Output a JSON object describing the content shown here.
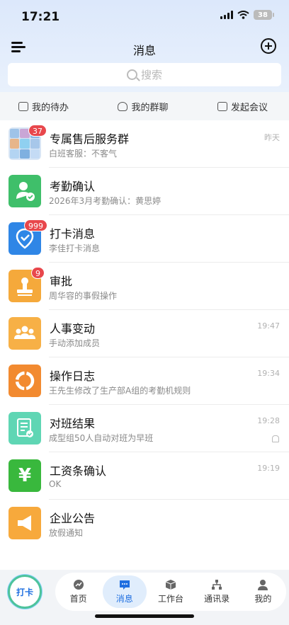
{
  "status": {
    "time": "17:21",
    "battery": "38"
  },
  "header": {
    "title": "消息"
  },
  "search": {
    "placeholder": "搜索"
  },
  "quick_actions": [
    {
      "label": "我的待办",
      "icon": "todo-icon"
    },
    {
      "label": "我的群聊",
      "icon": "group-chat-icon"
    },
    {
      "label": "发起会议",
      "icon": "meeting-icon"
    }
  ],
  "messages": [
    {
      "title": "专属售后服务群",
      "subtitle": "白班客服：不客气",
      "time": "昨天",
      "badge": "37",
      "icon": "group-avatar-icon",
      "color": "#d9e6f5"
    },
    {
      "title": "考勤确认",
      "subtitle": "2026年3月考勤确认：黄思婷",
      "time": "",
      "badge": "",
      "icon": "attendance-confirm-icon",
      "color": "#3fbf6a"
    },
    {
      "title": "打卡消息",
      "subtitle": "李佳打卡消息",
      "time": "",
      "badge": "999",
      "icon": "location-check-icon",
      "color": "#2f86e6"
    },
    {
      "title": "审批",
      "subtitle": "周华容的事假操作",
      "time": "",
      "badge": "9",
      "icon": "stamp-icon",
      "color": "#f5a93b"
    },
    {
      "title": "人事变动",
      "subtitle": "手动添加成员",
      "time": "19:47",
      "badge": "",
      "icon": "people-icon",
      "color": "#f7b046"
    },
    {
      "title": "操作日志",
      "subtitle": "王先生修改了生产部A组的考勤机规则",
      "time": "19:34",
      "badge": "",
      "icon": "log-ring-icon",
      "color": "#f28a30"
    },
    {
      "title": "对班结果",
      "subtitle": "成型组50人自动对班为早班",
      "time": "19:28",
      "badge": "",
      "icon": "document-check-icon",
      "color": "#5fd6b4",
      "muted": true
    },
    {
      "title": "工资条确认",
      "subtitle": "OK",
      "time": "19:19",
      "badge": "",
      "icon": "yen-icon",
      "color": "#39b83d"
    },
    {
      "title": "企业公告",
      "subtitle": "放假通知",
      "time": "",
      "badge": "",
      "icon": "megaphone-icon",
      "color": "#f7a93c"
    }
  ],
  "tabbar": {
    "punch_label": "打卡",
    "tabs": [
      {
        "label": "首页",
        "icon": "home-icon"
      },
      {
        "label": "消息",
        "icon": "message-icon",
        "active": true
      },
      {
        "label": "工作台",
        "icon": "workbench-icon"
      },
      {
        "label": "通讯录",
        "icon": "contacts-icon"
      },
      {
        "label": "我的",
        "icon": "profile-icon"
      }
    ]
  }
}
